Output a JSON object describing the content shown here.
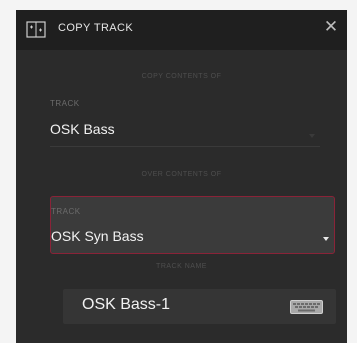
{
  "dialog": {
    "title": "COPY TRACK",
    "close_icon": "close-icon",
    "title_icon": "copy-track-icon"
  },
  "source": {
    "section_label": "COPY CONTENTS OF",
    "field_label": "TRACK",
    "value": "OSK Bass",
    "dropdown_icon": "chevron-down-icon",
    "enabled": false
  },
  "destination": {
    "section_label": "OVER CONTENTS OF",
    "field_label": "TRACK",
    "value": "OSK Syn Bass",
    "dropdown_icon": "chevron-down-icon",
    "highlight_color": "#8a2338"
  },
  "track_name": {
    "section_label": "TRACK NAME",
    "value": "OSK Bass-1",
    "keyboard_icon": "keyboard-icon"
  }
}
